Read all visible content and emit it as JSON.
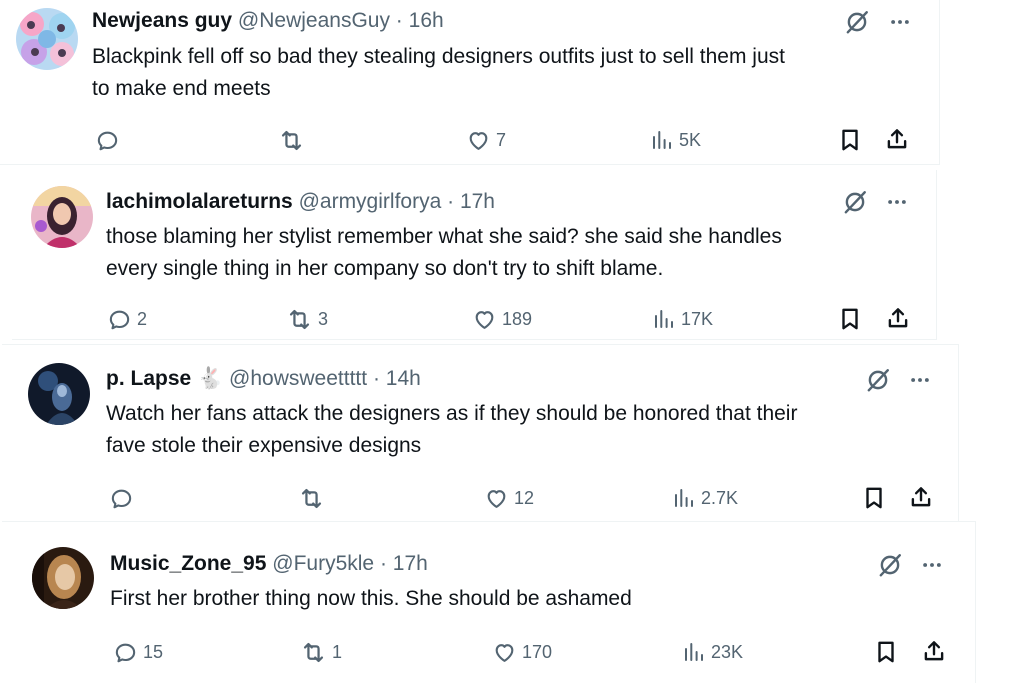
{
  "tweets": [
    {
      "name": "Newjeans guy",
      "handle": "@NewjeansGuy",
      "separator": "·",
      "time": "16h",
      "lines": [
        "Blackpink fell off so bad they stealing designers outfits just to sell them just",
        "to make end meets"
      ],
      "replies": "",
      "reposts": "",
      "likes": "7",
      "views": "5K"
    },
    {
      "name": "lachimolalareturns",
      "handle": "@armygirlforya",
      "separator": "·",
      "time": "17h",
      "lines": [
        "those blaming her stylist remember what she said? she said she handles",
        "every single thing in her company so don't try to shift blame."
      ],
      "replies": "2",
      "reposts": "3",
      "likes": "189",
      "views": "17K"
    },
    {
      "name": "p. Lapse",
      "name_emoji": "🐇",
      "handle": "@howsweettttt",
      "separator": "·",
      "time": "14h",
      "lines": [
        "Watch her fans attack the designers as if they should be honored that their",
        "fave stole their expensive designs"
      ],
      "replies": "",
      "reposts": "",
      "likes": "12",
      "views": "2.7K"
    },
    {
      "name": "Music_Zone_95",
      "handle": "@Fury5kle",
      "separator": "·",
      "time": "17h",
      "lines": [
        "First her brother thing now this. She should be ashamed"
      ],
      "replies": "15",
      "reposts": "1",
      "likes": "170",
      "views": "23K"
    }
  ],
  "icons": {
    "grok": "grok-icon",
    "more": "more-icon",
    "reply": "reply-icon",
    "repost": "repost-icon",
    "like": "heart-icon",
    "views": "views-icon",
    "bookmark": "bookmark-icon",
    "share": "share-icon"
  },
  "colors": {
    "text": "#0f1419",
    "secondary": "#536471",
    "border": "#eff3f4"
  }
}
